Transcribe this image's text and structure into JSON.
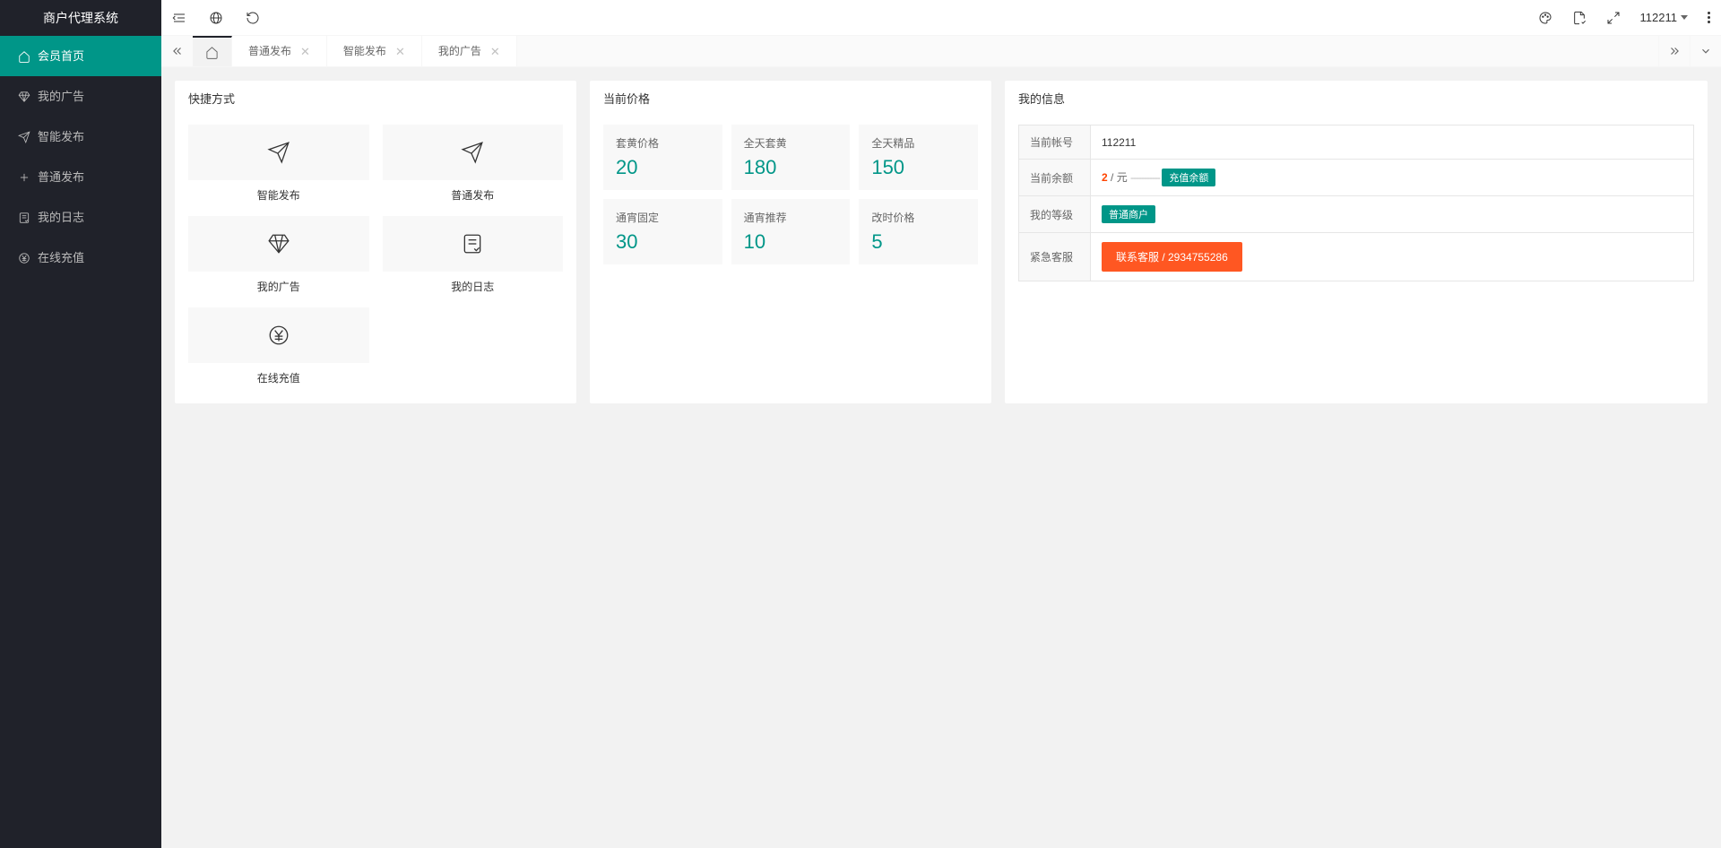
{
  "app_title": "商户代理系统",
  "sidebar": {
    "items": [
      {
        "label": "会员首页",
        "icon": "home",
        "active": true
      },
      {
        "label": "我的广告",
        "icon": "diamond",
        "active": false
      },
      {
        "label": "智能发布",
        "icon": "send",
        "active": false
      },
      {
        "label": "普通发布",
        "icon": "plus",
        "active": false
      },
      {
        "label": "我的日志",
        "icon": "note",
        "active": false
      },
      {
        "label": "在线充值",
        "icon": "yen",
        "active": false
      }
    ]
  },
  "header": {
    "username": "112211"
  },
  "tabs": [
    {
      "label": "普通发布",
      "closable": true
    },
    {
      "label": "智能发布",
      "closable": true
    },
    {
      "label": "我的广告",
      "closable": true
    }
  ],
  "shortcuts": {
    "title": "快捷方式",
    "items": [
      {
        "label": "智能发布",
        "icon": "send"
      },
      {
        "label": "普通发布",
        "icon": "send"
      },
      {
        "label": "我的广告",
        "icon": "diamond"
      },
      {
        "label": "我的日志",
        "icon": "note"
      },
      {
        "label": "在线充值",
        "icon": "yen"
      }
    ]
  },
  "prices": {
    "title": "当前价格",
    "items": [
      {
        "label": "套黄价格",
        "value": "20"
      },
      {
        "label": "全天套黄",
        "value": "180"
      },
      {
        "label": "全天精品",
        "value": "150"
      },
      {
        "label": "通宵固定",
        "value": "30"
      },
      {
        "label": "通宵推荐",
        "value": "10"
      },
      {
        "label": "改时价格",
        "value": "5"
      }
    ]
  },
  "info": {
    "title": "我的信息",
    "account_label": "当前帐号",
    "account_value": "112211",
    "balance_label": "当前余额",
    "balance_value": "2",
    "balance_unit": " / 元",
    "recharge_btn": "充值余额",
    "level_label": "我的等级",
    "level_value": "普通商户",
    "support_label": "紧急客服",
    "support_btn": "联系客服 / 2934755286"
  }
}
